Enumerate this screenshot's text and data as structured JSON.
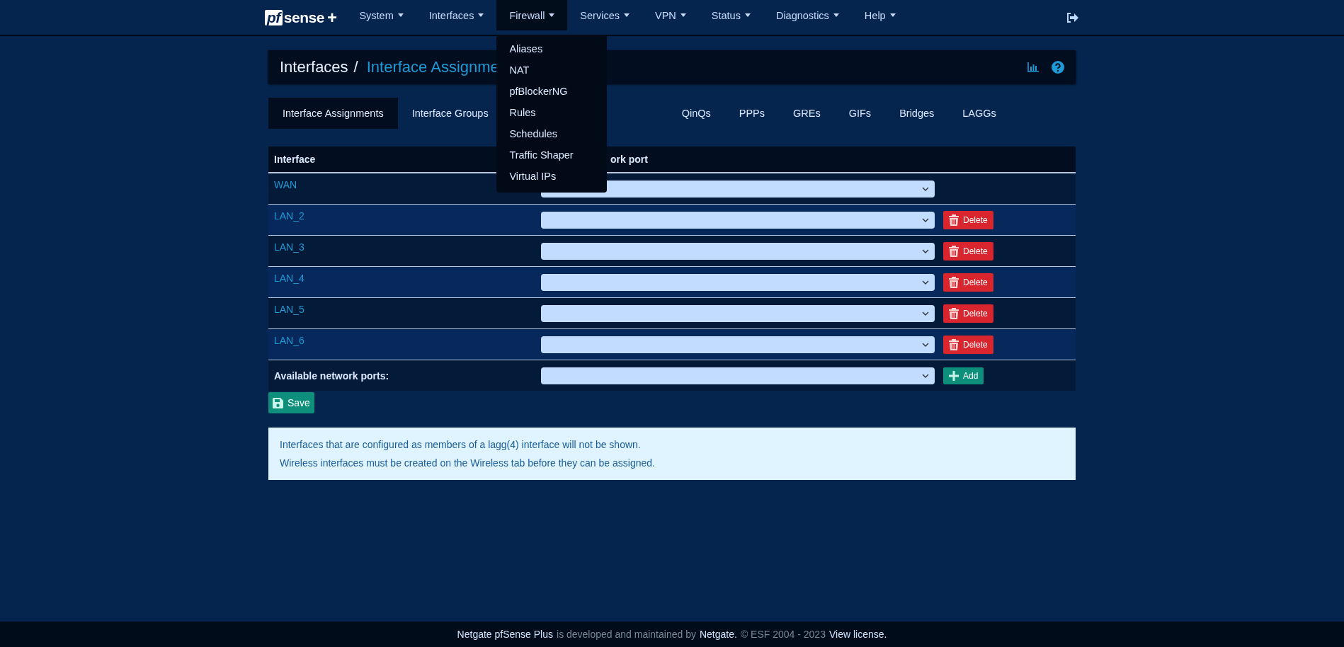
{
  "navbar": {
    "logo": {
      "boxed": "pf",
      "text": "sense",
      "plus": "+"
    },
    "menus": [
      {
        "label": "System",
        "selected": false
      },
      {
        "label": "Interfaces",
        "selected": false
      },
      {
        "label": "Firewall",
        "selected": true,
        "items": [
          "Aliases",
          "NAT",
          "pfBlockerNG",
          "Rules",
          "Schedules",
          "Traffic Shaper",
          "Virtual IPs"
        ]
      },
      {
        "label": "Services",
        "selected": false
      },
      {
        "label": "VPN",
        "selected": false
      },
      {
        "label": "Status",
        "selected": false
      },
      {
        "label": "Diagnostics",
        "selected": false
      },
      {
        "label": "Help",
        "selected": false
      }
    ]
  },
  "breadcrumb": {
    "parent": "Interfaces",
    "separator": "/",
    "current": "Interface Assignme"
  },
  "tabs": [
    {
      "label": "Interface Assignments",
      "selected": true
    },
    {
      "label": "Interface Groups",
      "selected": false
    },
    {
      "kind": "covered"
    },
    {
      "label": "QinQs",
      "selected": false
    },
    {
      "label": "PPPs",
      "selected": false
    },
    {
      "label": "GREs",
      "selected": false
    },
    {
      "label": "GIFs",
      "selected": false
    },
    {
      "label": "Bridges",
      "selected": false
    },
    {
      "label": "LAGGs",
      "selected": false
    }
  ],
  "table": {
    "columns": [
      "Interface",
      "ork port"
    ],
    "rows": [
      {
        "name": "WAN",
        "action": null
      },
      {
        "name": "LAN_2",
        "action": "Delete"
      },
      {
        "name": "LAN_3",
        "action": "Delete"
      },
      {
        "name": "LAN_4",
        "action": "Delete"
      },
      {
        "name": "LAN_5",
        "action": "Delete"
      },
      {
        "name": "LAN_6",
        "action": "Delete"
      }
    ],
    "add_row": {
      "label": "Available network ports:",
      "action": "Add"
    }
  },
  "save_button": "Save",
  "notes": [
    "Interfaces that are configured as members of a lagg(4) interface will not be shown.",
    "Wireless interfaces must be created on the Wireless tab before they can be assigned."
  ],
  "footer": [
    {
      "text": "Netgate pfSense Plus",
      "kind": "link"
    },
    {
      "text": "is developed and maintained by",
      "kind": "plain"
    },
    {
      "text": "Netgate.",
      "kind": "link"
    },
    {
      "text": "© ESF 2004 - 2023",
      "kind": "plain"
    },
    {
      "text": "View license.",
      "kind": "link"
    }
  ]
}
